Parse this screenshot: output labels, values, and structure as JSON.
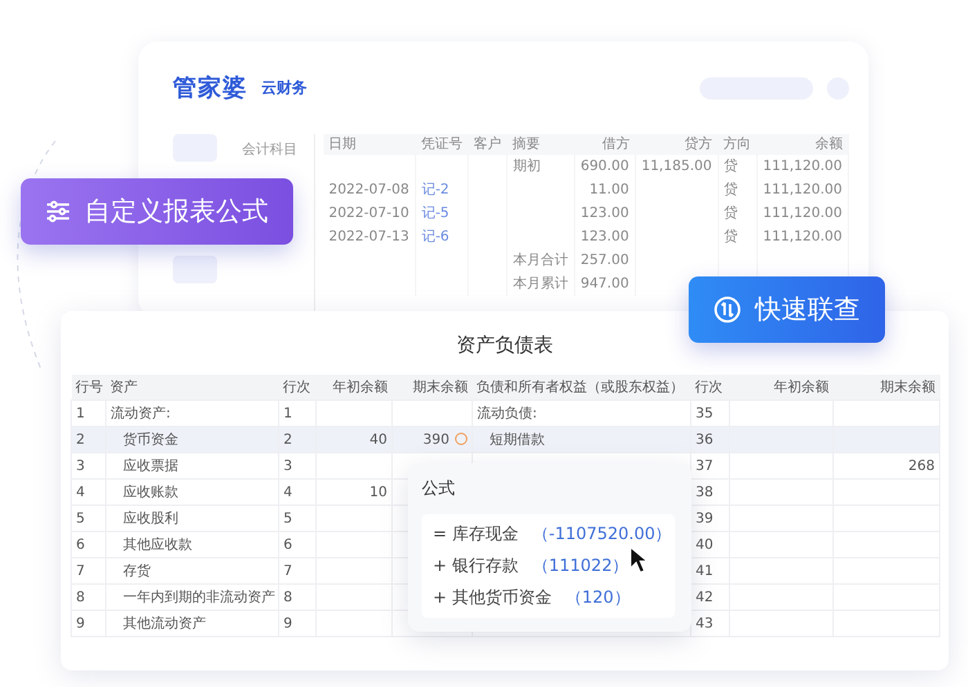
{
  "back_window": {
    "logo": {
      "brand": "管家婆",
      "sub": "云财务"
    },
    "panel_title": "会计科目",
    "ledger": {
      "columns": [
        "日期",
        "凭证号",
        "客户",
        "摘要",
        "借方",
        "贷方",
        "方向",
        "余额"
      ],
      "rows": [
        [
          "",
          "",
          "",
          "期初",
          "690.00",
          "11,185.00",
          "贷",
          "111,120.00"
        ],
        [
          "2022-07-08",
          "记-2",
          "",
          "",
          "11.00",
          "",
          "贷",
          "111,120.00"
        ],
        [
          "2022-07-10",
          "记-5",
          "",
          "",
          "123.00",
          "",
          "贷",
          "111,120.00"
        ],
        [
          "2022-07-13",
          "记-6",
          "",
          "",
          "123.00",
          "",
          "贷",
          "111,120.00"
        ],
        [
          "",
          "",
          "",
          "本月合计",
          "257.00",
          "",
          "",
          ""
        ],
        [
          "",
          "",
          "",
          "本月累计",
          "947.00",
          "",
          "",
          ""
        ]
      ]
    }
  },
  "report": {
    "title": "资产负债表",
    "columns": [
      "行号",
      "资产",
      "行次",
      "年初余额",
      "期末余额",
      "负债和所有者权益（或股东权益）",
      "行次",
      "年初余额",
      "期末余额"
    ],
    "rows": [
      {
        "kind": "group",
        "selected": false,
        "alert": false,
        "cells": [
          "1",
          "流动资产:",
          "1",
          "",
          "",
          "流动负债:",
          "35",
          "",
          ""
        ]
      },
      {
        "kind": "item",
        "selected": true,
        "alert": true,
        "cells": [
          "2",
          "货币资金",
          "2",
          "40",
          "390",
          "短期借款",
          "36",
          "",
          ""
        ]
      },
      {
        "kind": "item",
        "selected": false,
        "alert": false,
        "cells": [
          "3",
          "应收票据",
          "3",
          "",
          "",
          "",
          "37",
          "",
          "268"
        ]
      },
      {
        "kind": "item",
        "selected": false,
        "alert": false,
        "cells": [
          "4",
          "应收账款",
          "4",
          "10",
          "",
          "",
          "38",
          "",
          ""
        ]
      },
      {
        "kind": "item",
        "selected": false,
        "alert": false,
        "cells": [
          "5",
          "应收股利",
          "5",
          "",
          "",
          "",
          "39",
          "",
          ""
        ]
      },
      {
        "kind": "item",
        "selected": false,
        "alert": false,
        "cells": [
          "6",
          "其他应收款",
          "6",
          "",
          "",
          "",
          "40",
          "",
          ""
        ]
      },
      {
        "kind": "item",
        "selected": false,
        "alert": false,
        "cells": [
          "7",
          "存货",
          "7",
          "",
          "",
          "",
          "41",
          "",
          ""
        ]
      },
      {
        "kind": "item",
        "selected": false,
        "alert": false,
        "cells": [
          "8",
          "一年内到期的非流动资产",
          "8",
          "",
          "",
          "",
          "42",
          "",
          ""
        ]
      },
      {
        "kind": "item",
        "selected": false,
        "alert": false,
        "cells": [
          "9",
          "其他流动资产",
          "9",
          "",
          "",
          "",
          "43",
          "",
          ""
        ]
      }
    ]
  },
  "formula_popup": {
    "title": "公式",
    "lines": [
      {
        "op": "=",
        "name": "库存现金",
        "value": "（-1107520.00）"
      },
      {
        "op": "+",
        "name": "银行存款",
        "value": "（111022）"
      },
      {
        "op": "+",
        "name": "其他货币资金",
        "value": "（120）"
      }
    ]
  },
  "badges": [
    {
      "kind": "formula",
      "label": "自定义报表公式"
    },
    {
      "kind": "lookup",
      "label": "快速联查"
    }
  ]
}
